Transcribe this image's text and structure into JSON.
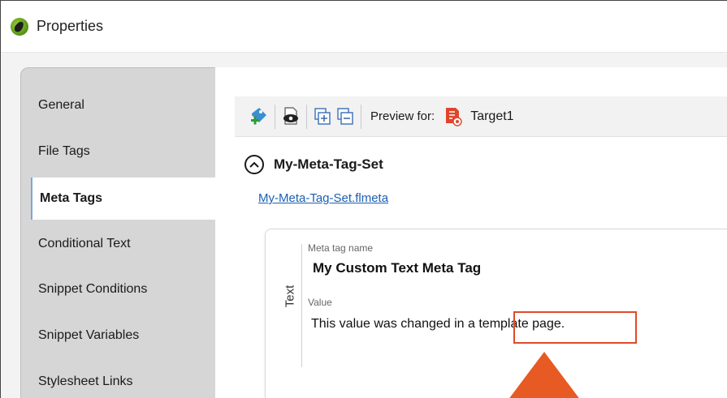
{
  "window": {
    "title": "Properties"
  },
  "sidebar": {
    "items": [
      {
        "label": "General",
        "active": false
      },
      {
        "label": "File Tags",
        "active": false
      },
      {
        "label": "Meta Tags",
        "active": true
      },
      {
        "label": "Conditional Text",
        "active": false
      },
      {
        "label": "Snippet Conditions",
        "active": false
      },
      {
        "label": "Snippet Variables",
        "active": false
      },
      {
        "label": "Stylesheet Links",
        "active": false
      }
    ]
  },
  "toolbar": {
    "buttons": [
      "add-meta-tag-set-icon",
      "preview-icon",
      "expand-all-icon",
      "collapse-all-icon"
    ],
    "preview_label": "Preview for:",
    "target_label": "Target1"
  },
  "meta_tag_set": {
    "name": "My-Meta-Tag-Set",
    "file": "My-Meta-Tag-Set.flmeta",
    "tag": {
      "type_label": "Text",
      "name_caption": "Meta tag name",
      "name": "My Custom Text Meta Tag",
      "value_caption": "Value",
      "value": "This value was changed in a template page."
    }
  },
  "colors": {
    "highlight": "#e2492b",
    "arrow": "#e85a23",
    "link": "#1a5fb4"
  }
}
